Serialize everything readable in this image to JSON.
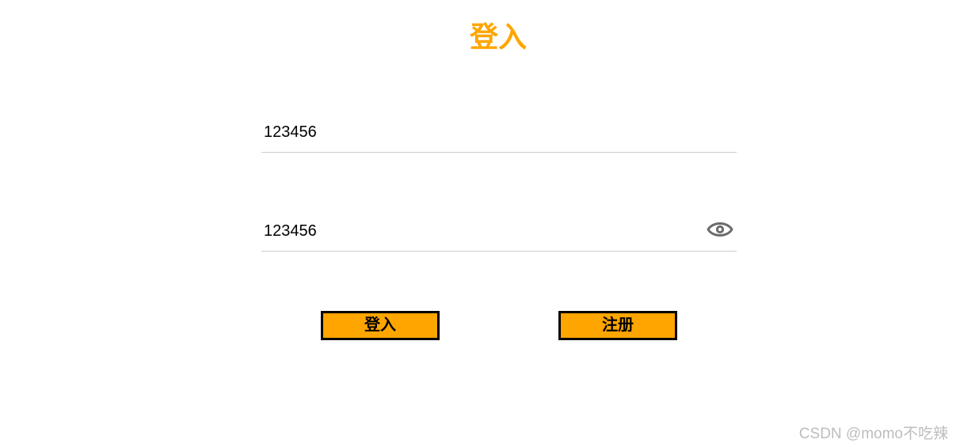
{
  "page": {
    "title": "登入"
  },
  "form": {
    "username": {
      "value": "123456",
      "placeholder": ""
    },
    "password": {
      "value": "123456",
      "placeholder": "",
      "toggle_icon": "eye-icon"
    }
  },
  "buttons": {
    "login_label": "登入",
    "register_label": "注册"
  },
  "watermark": {
    "text": "CSDN @momo不吃辣"
  },
  "colors": {
    "accent": "#ffa500",
    "button_border": "#000000",
    "divider": "#cccccc",
    "icon": "#6b6b6b",
    "watermark": "#bdbdbd"
  }
}
